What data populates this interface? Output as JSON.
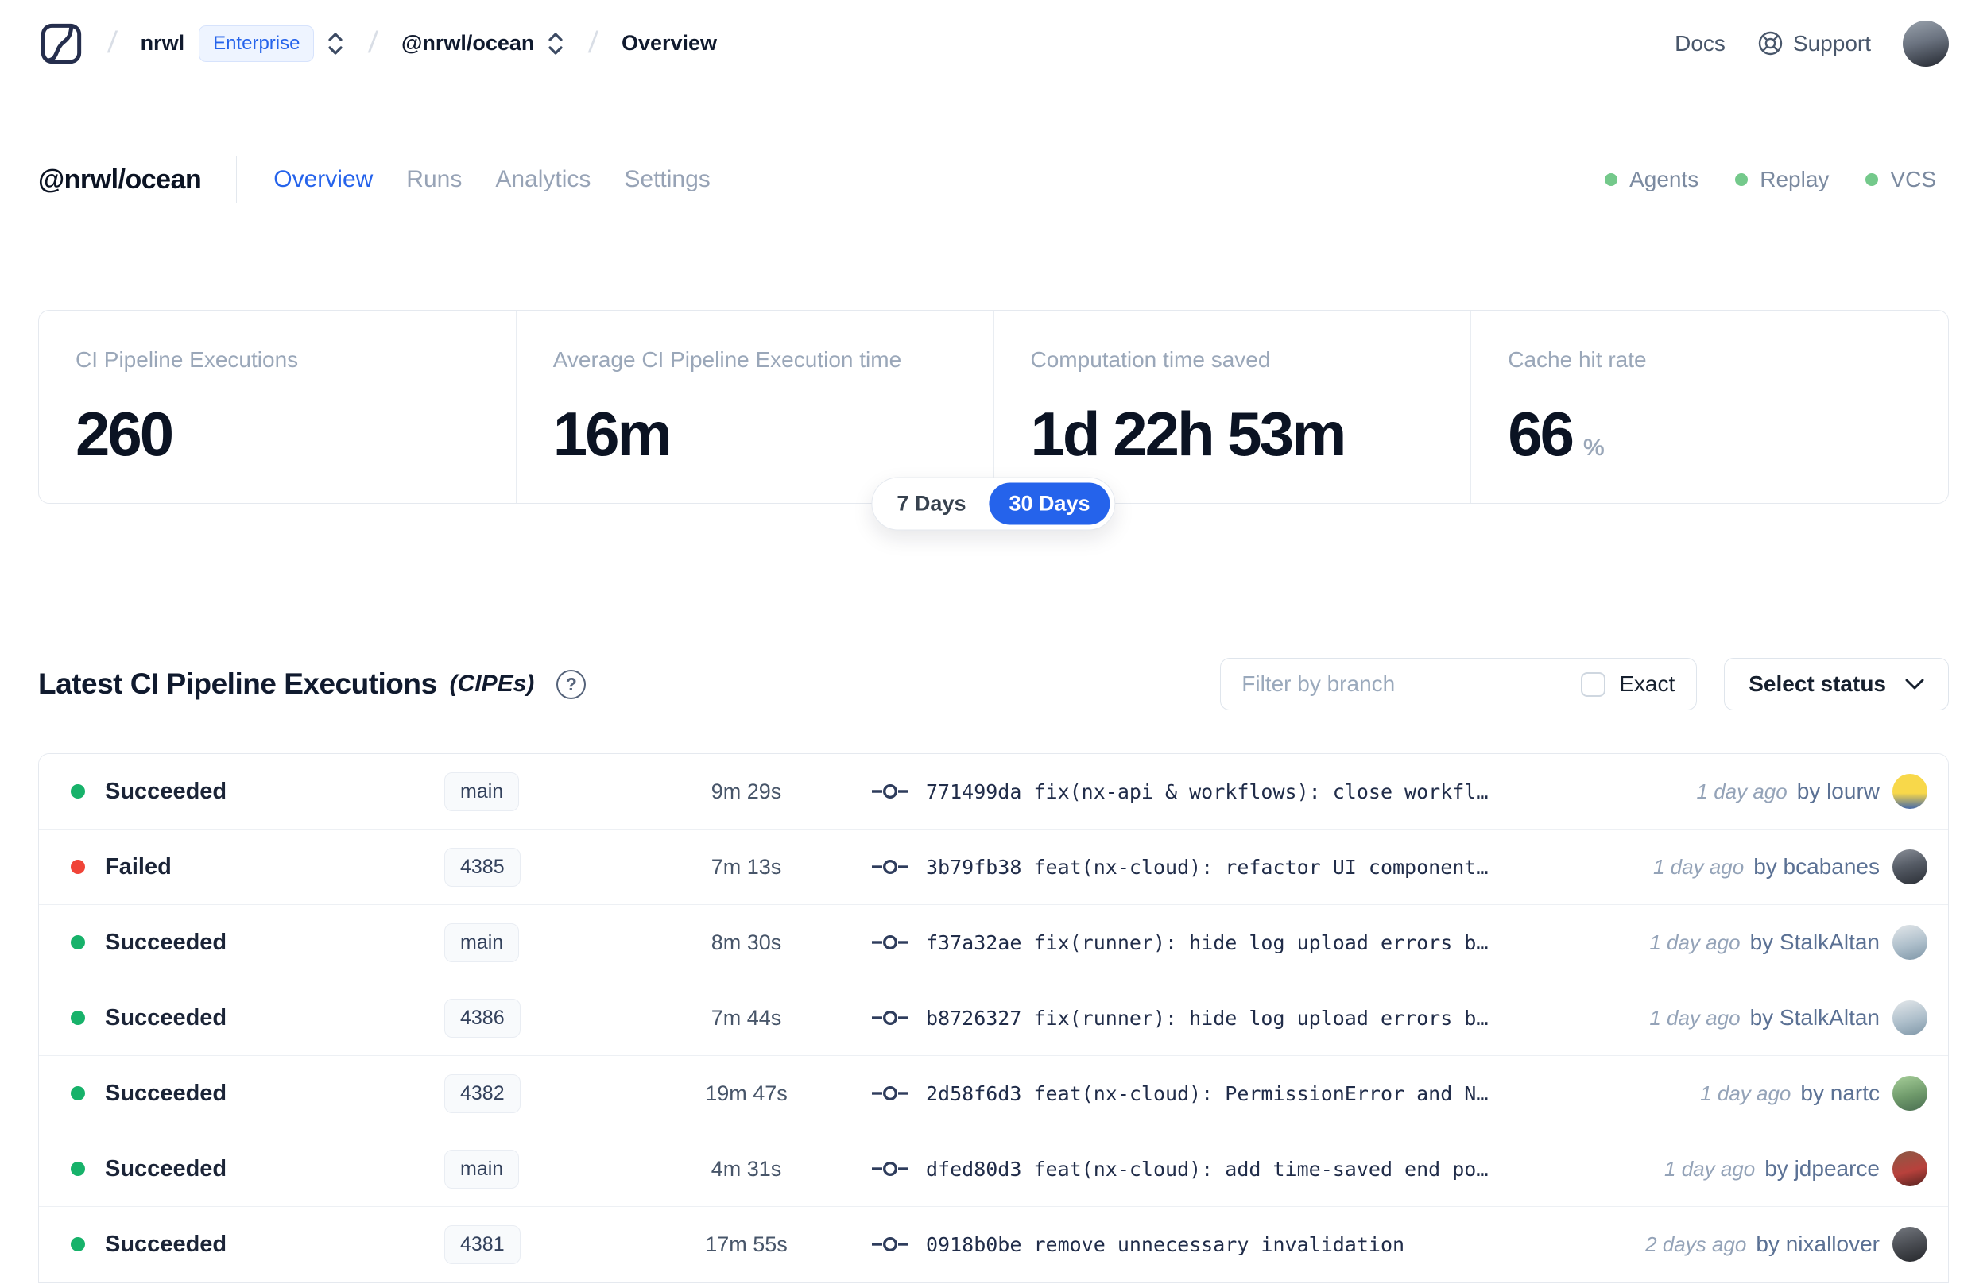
{
  "topbar": {
    "separator": "/",
    "org": "nrwl",
    "org_badge": "Enterprise",
    "workspace": "@nrwl/ocean",
    "page": "Overview",
    "docs_label": "Docs",
    "support_label": "Support",
    "avatar_bg": "linear-gradient(165deg, #9aa3ad 0%, #6b7380 45%, #23272f 100%)"
  },
  "header": {
    "title": "@nrwl/ocean",
    "tabs": [
      {
        "label": "Overview"
      },
      {
        "label": "Runs"
      },
      {
        "label": "Analytics"
      },
      {
        "label": "Settings"
      }
    ],
    "active_tab": "Overview",
    "services": [
      {
        "label": "Agents"
      },
      {
        "label": "Replay"
      },
      {
        "label": "VCS"
      }
    ],
    "service_dot_color": "#74c98b"
  },
  "stats": {
    "cards": [
      {
        "label": "CI Pipeline Executions",
        "value": "260",
        "suffix": ""
      },
      {
        "label": "Average CI Pipeline Execution time",
        "value": "16m",
        "suffix": ""
      },
      {
        "label": "Computation time saved",
        "value": "1d 22h 53m",
        "suffix": ""
      },
      {
        "label": "Cache hit rate",
        "value": "66",
        "suffix": "%"
      }
    ],
    "range_toggle": {
      "options": [
        "7 Days",
        "30 Days"
      ],
      "selected": "30 Days"
    }
  },
  "cipe_section": {
    "title": "Latest CI Pipeline Executions",
    "title_suffix": "(CIPEs)",
    "help_glyph": "?",
    "filter_placeholder": "Filter by branch",
    "exact_label": "Exact",
    "exact_checked": false,
    "status_dropdown_label": "Select status",
    "rows": [
      {
        "status": "Succeeded",
        "status_color": "#17b26a",
        "branch": "main",
        "duration": "9m 29s",
        "commit": "771499da fix(nx-api & workflows): close workfl…",
        "time_ago": "1 day ago",
        "author": "by lourw",
        "avatar_bg": "linear-gradient(180deg, #f8d84a 55%, #4669a8 100%)"
      },
      {
        "status": "Failed",
        "status_color": "#f04438",
        "branch": "4385",
        "duration": "7m 13s",
        "commit": "3b79fb38 feat(nx-cloud): refactor UI component…",
        "time_ago": "1 day ago",
        "author": "by bcabanes",
        "avatar_bg": "linear-gradient(165deg, #8a8f98 0%, #565c66 45%, #2b2f36 100%)"
      },
      {
        "status": "Succeeded",
        "status_color": "#17b26a",
        "branch": "main",
        "duration": "8m 30s",
        "commit": "f37a32ae fix(runner): hide log upload errors b…",
        "time_ago": "1 day ago",
        "author": "by StalkAltan",
        "avatar_bg": "linear-gradient(165deg, #e3e7ea 0%, #aebfcb 55%, #7f97a8 100%)"
      },
      {
        "status": "Succeeded",
        "status_color": "#17b26a",
        "branch": "4386",
        "duration": "7m 44s",
        "commit": "b8726327 fix(runner): hide log upload errors b…",
        "time_ago": "1 day ago",
        "author": "by StalkAltan",
        "avatar_bg": "linear-gradient(165deg, #e3e7ea 0%, #aebfcb 55%, #7f97a8 100%)"
      },
      {
        "status": "Succeeded",
        "status_color": "#17b26a",
        "branch": "4382",
        "duration": "19m 47s",
        "commit": "2d58f6d3 feat(nx-cloud): PermissionError and N…",
        "time_ago": "1 day ago",
        "author": "by nartc",
        "avatar_bg": "linear-gradient(165deg, #a7cf9a 0%, #6f9a6b 55%, #4a6e51 100%)"
      },
      {
        "status": "Succeeded",
        "status_color": "#17b26a",
        "branch": "main",
        "duration": "4m 31s",
        "commit": "dfed80d3 feat(nx-cloud): add time-saved end po…",
        "time_ago": "1 day ago",
        "author": "by jdpearce",
        "avatar_bg": "linear-gradient(165deg, #8a5a46 0%, #b8413c 55%, #53221f 100%)"
      },
      {
        "status": "Succeeded",
        "status_color": "#17b26a",
        "branch": "4381",
        "duration": "17m 55s",
        "commit": "0918b0be remove unnecessary invalidation",
        "time_ago": "2 days ago",
        "author": "by nixallover",
        "avatar_bg": "linear-gradient(165deg, #74787f 0%, #4a4d53 50%, #26282c 100%)"
      }
    ]
  }
}
